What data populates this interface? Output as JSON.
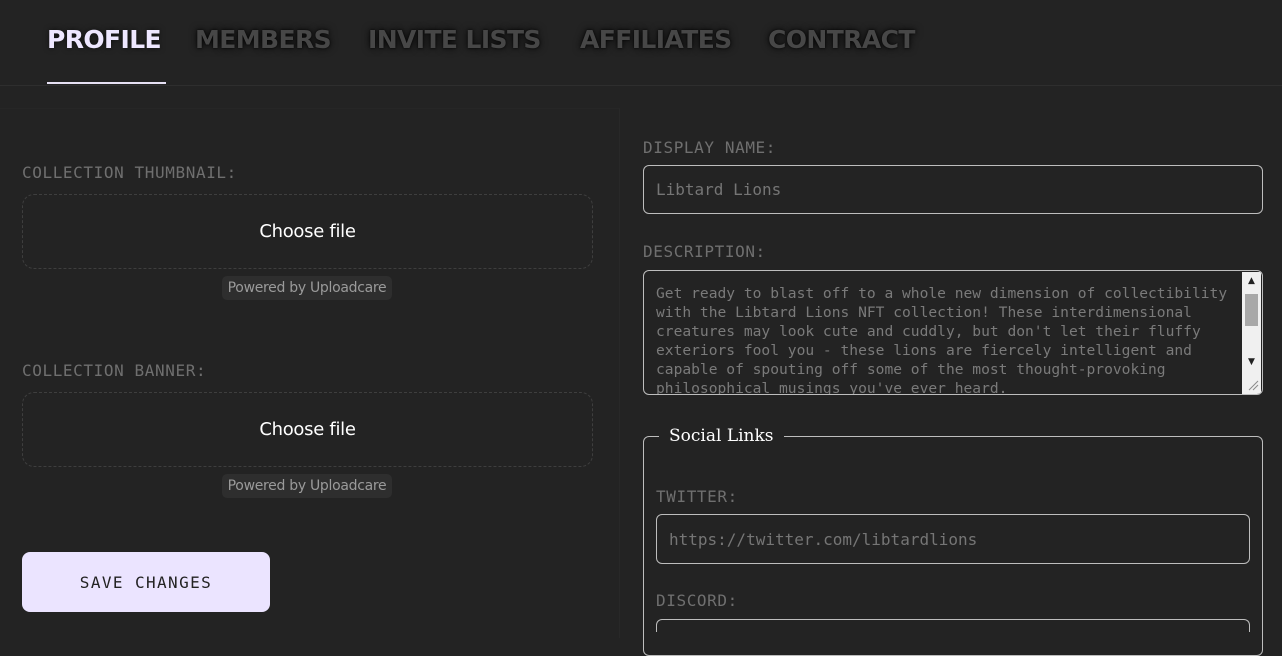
{
  "nav": {
    "tabs": [
      {
        "label": "PROFILE",
        "active": true
      },
      {
        "label": "MEMBERS",
        "active": false
      },
      {
        "label": "INVITE LISTS",
        "active": false
      },
      {
        "label": "AFFILIATES",
        "active": false
      },
      {
        "label": "CONTRACT",
        "active": false
      }
    ]
  },
  "left": {
    "thumbnail_label": "COLLECTION THUMBNAIL:",
    "thumbnail_button": "Choose file",
    "thumbnail_powered": "Powered by Uploadcare",
    "banner_label": "COLLECTION BANNER:",
    "banner_button": "Choose file",
    "banner_powered": "Powered by Uploadcare",
    "save_label": "SAVE CHANGES"
  },
  "right": {
    "display_name_label": "DISPLAY NAME:",
    "display_name_placeholder": "Libtard Lions",
    "description_label": "DESCRIPTION:",
    "description_text": "Get ready to blast off to a whole new dimension of collectibility with the Libtard Lions NFT collection! These interdimensional creatures may look cute and cuddly, but don't let their fluffy exteriors fool you - these lions are fiercely intelligent and capable of spouting off some of the most thought-provoking philosophical musings you've ever heard.",
    "social_legend": "Social Links",
    "twitter_label": "TWITTER:",
    "twitter_placeholder": "https://twitter.com/libtardlions",
    "discord_label": "DISCORD:",
    "discord_placeholder": ""
  },
  "colors": {
    "background": "#232323",
    "active_tab": "#eee7ff",
    "inactive_tab": "#474747",
    "button_bg": "#ebe4ff",
    "label": "#6f6f6f"
  },
  "icons": [
    "scroll-up-arrow-icon",
    "scroll-down-arrow-icon",
    "resize-grip-icon"
  ]
}
